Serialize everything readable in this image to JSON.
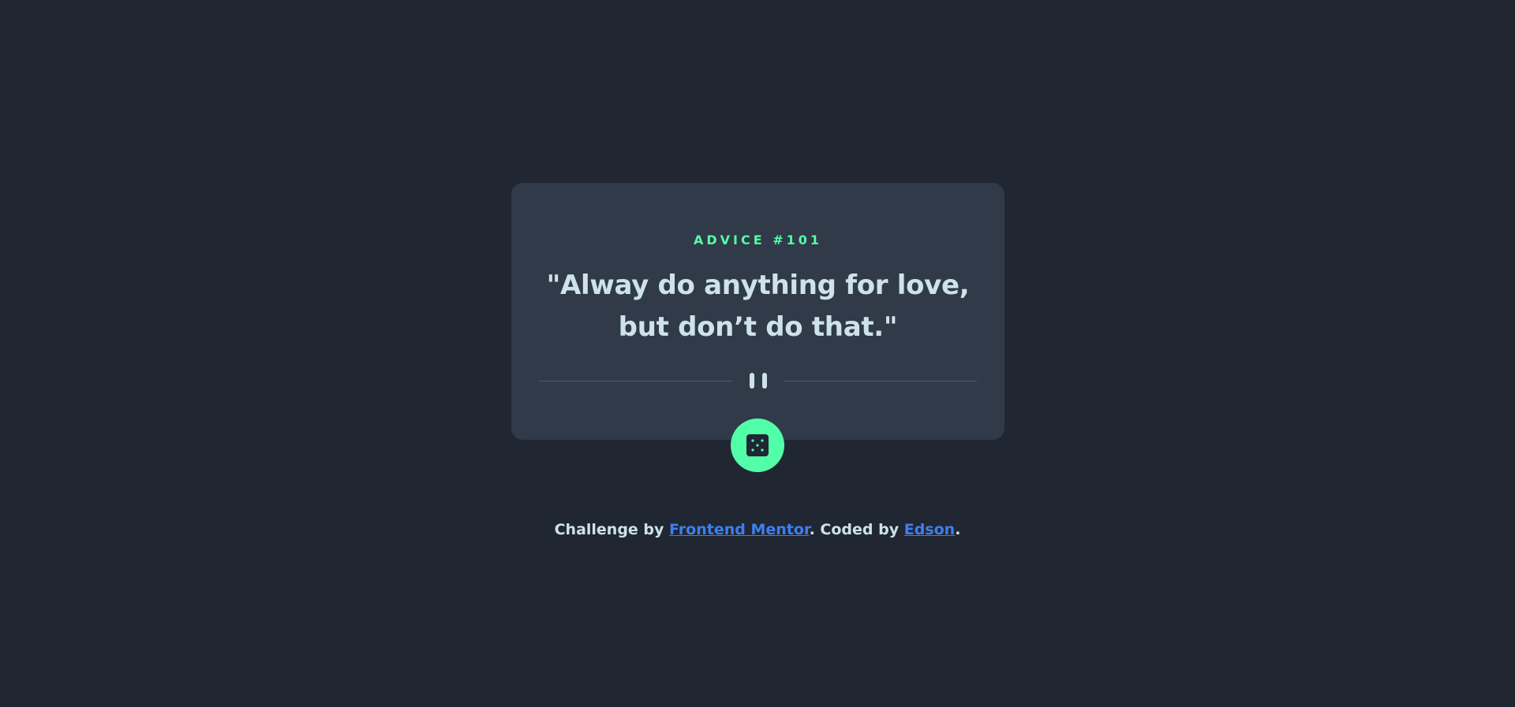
{
  "card": {
    "advice_label": "ADVICE #101",
    "advice_text": "\"Alway do anything for love, but don’t do that.\""
  },
  "divider": {
    "icon": "pause-icon"
  },
  "dice_button": {
    "icon": "dice-icon"
  },
  "footer": {
    "prefix": "Challenge by ",
    "link1": "Frontend Mentor",
    "middle": ". Coded by ",
    "link2": "Edson",
    "suffix": "."
  },
  "colors": {
    "background": "#202632",
    "card": "#313a49",
    "accent": "#52ffa8",
    "text": "#cee3e9",
    "link": "#3e7ff0",
    "divider": "#4f5d74"
  }
}
